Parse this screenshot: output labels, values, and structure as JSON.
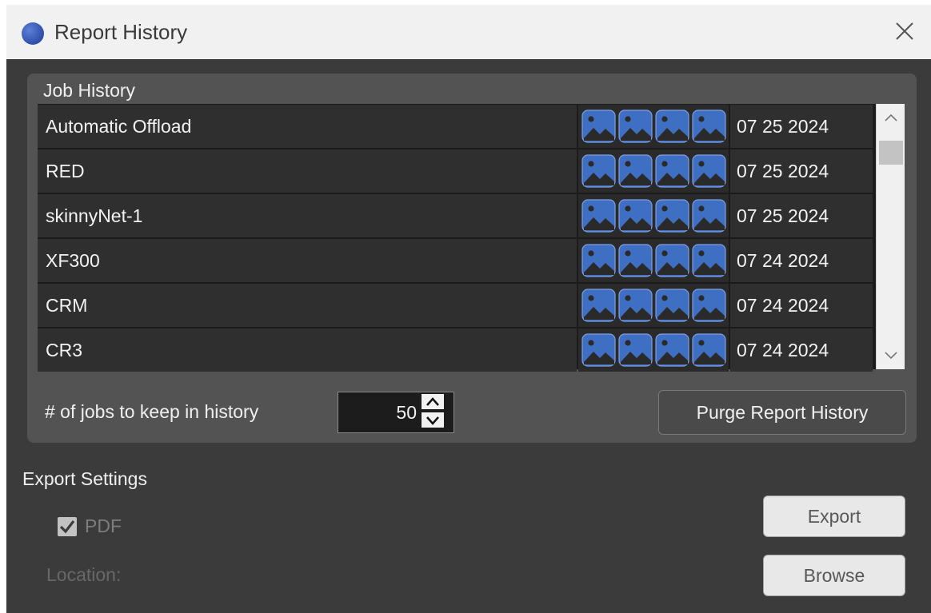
{
  "window": {
    "title": "Report History",
    "app_icon": "app-logo-icon",
    "close_icon": "close-icon"
  },
  "job_history": {
    "title": "Job History",
    "rows": [
      {
        "name": "Automatic Offload",
        "date": "07 25 2024"
      },
      {
        "name": "RED",
        "date": "07 25 2024"
      },
      {
        "name": "skinnyNet-1",
        "date": "07 25 2024"
      },
      {
        "name": "XF300",
        "date": "07 24 2024"
      },
      {
        "name": "CRM",
        "date": "07 24 2024"
      },
      {
        "name": "CR3",
        "date": "07 24 2024"
      }
    ],
    "thumbnail_icon": "image-icon",
    "thumbnail_color": "#3f6fc2",
    "keep_label": "# of jobs to keep in history",
    "keep_value": "50",
    "purge_label": "Purge Report History"
  },
  "export": {
    "title": "Export Settings",
    "pdf_label": "PDF",
    "pdf_checked": true,
    "location_label": "Location:",
    "export_label": "Export",
    "browse_label": "Browse"
  }
}
